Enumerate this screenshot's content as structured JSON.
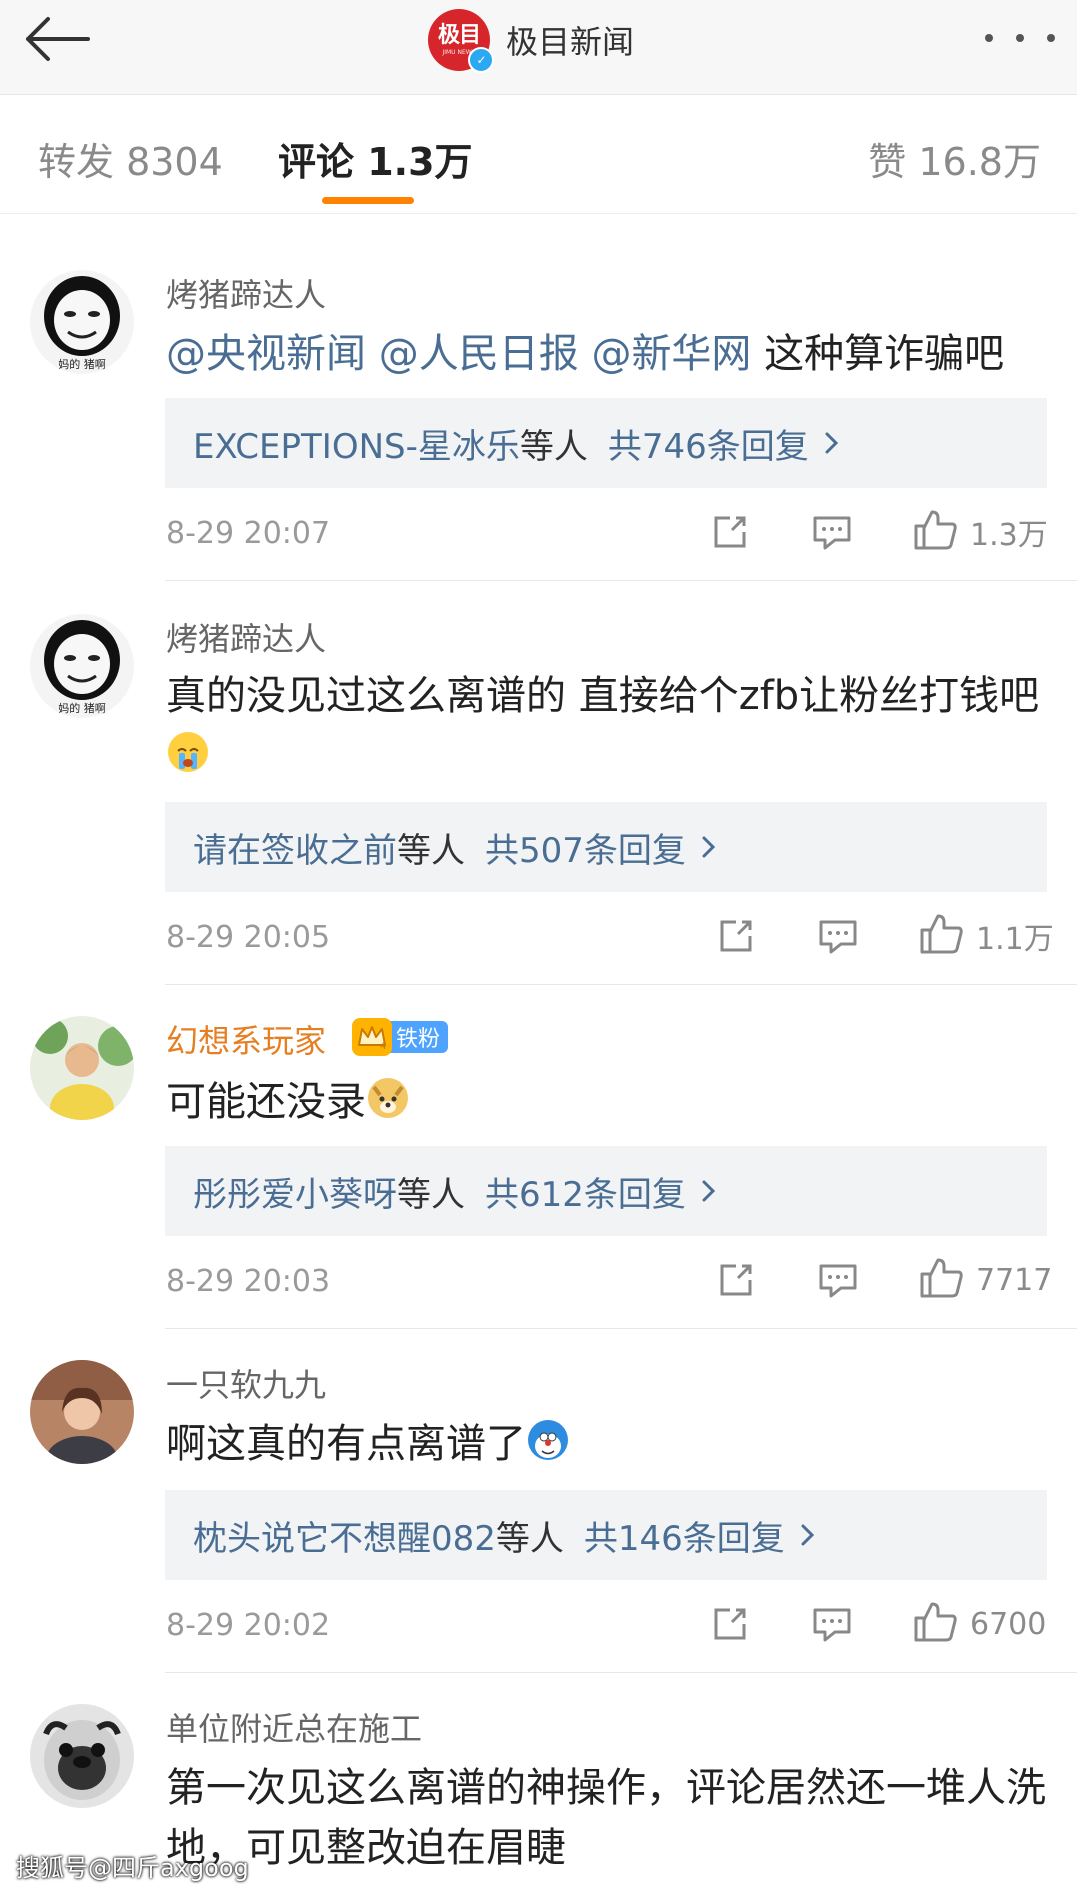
{
  "header": {
    "brand_name": "极目新闻",
    "logo_text": "极目",
    "logo_subtext": "JIMU NEWS"
  },
  "tabs": {
    "repost": "转发 8304",
    "comments": "评论 1.3万",
    "likes": "赞 16.8万"
  },
  "comments": [
    {
      "username": "烤猪蹄达人",
      "mentions": [
        "@央视新闻",
        "@人民日报",
        "@新华网"
      ],
      "text_after_mentions": "这种算诈骗吧",
      "reply_who": "EXCEPTIONS-星冰乐",
      "reply_etc": "等人",
      "reply_count": "共746条回复",
      "time": "8-29 20:07",
      "likes": "1.3万"
    },
    {
      "username": "烤猪蹄达人",
      "text": "真的没见过这么离谱的 直接给个zfb让粉丝打钱吧",
      "reply_who": "请在签收之前",
      "reply_etc": "等人",
      "reply_count": "共507条回复",
      "time": "8-29 20:05",
      "likes": "1.1万"
    },
    {
      "username": "幻想系玩家",
      "badge": "铁粉",
      "badge_level": "4",
      "text": "可能还没录",
      "reply_who": "彤彤爱小葵呀",
      "reply_etc": "等人",
      "reply_count": "共612条回复",
      "time": "8-29 20:03",
      "likes": "7717"
    },
    {
      "username": "一只软九九",
      "text": "啊这真的有点离谱了",
      "reply_who": "枕头说它不想醒082",
      "reply_etc": "等人",
      "reply_count": "共146条回复",
      "time": "8-29 20:02",
      "likes": "6700"
    },
    {
      "username": "单位附近总在施工",
      "text": "第一次见这么离谱的神操作，评论居然还一堆人洗地，可见整改迫在眉睫"
    }
  ],
  "avatar_caption": "妈的 猪啊",
  "watermark": "搜狐号@四斤axgoog"
}
